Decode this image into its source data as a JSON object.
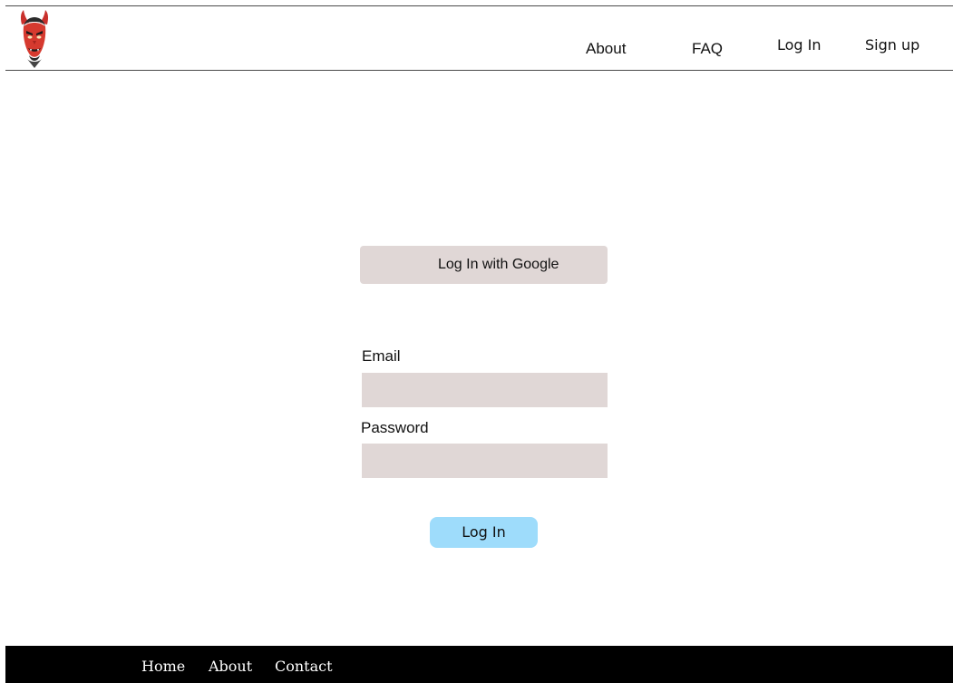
{
  "header": {
    "logo_icon": "oni-mask-logo",
    "nav": {
      "about": "About",
      "faq": "FAQ",
      "login": "Log In",
      "signup": "Sign up"
    }
  },
  "auth": {
    "google_button_label": "Log In with Google",
    "email_label": "Email",
    "email_value": "",
    "password_label": "Password",
    "password_value": "",
    "login_button_label": "Log In"
  },
  "footer": {
    "home": "Home",
    "about": "About",
    "contact": "Contact"
  },
  "colors": {
    "input_background": "#e0d7d6",
    "login_button": "#9edcfb",
    "footer_background": "#000000",
    "logo_red": "#d63a2f"
  }
}
